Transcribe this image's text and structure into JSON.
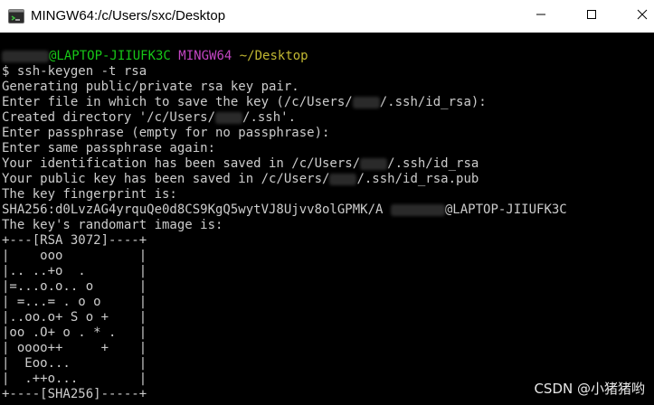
{
  "window": {
    "title": "MINGW64:/c/Users/sxc/Desktop"
  },
  "prompt": {
    "user_at_host": "@LAPTOP-JIIUFK3C",
    "shell": "MINGW64",
    "cwd": "~/Desktop",
    "symbol": "$",
    "command": "ssh-keygen -t rsa"
  },
  "output": {
    "l1": "Generating public/private rsa key pair.",
    "l2a": "Enter file in which to save the key (/c/Users/",
    "l2b": "/.ssh/id_rsa):",
    "l3a": "Created directory '/c/Users/",
    "l3b": "/.ssh'.",
    "l4": "Enter passphrase (empty for no passphrase):",
    "l5": "Enter same passphrase again:",
    "l6a": "Your identification has been saved in /c/Users/",
    "l6b": "/.ssh/id_rsa",
    "l7a": "Your public key has been saved in /c/Users/",
    "l7b": "/.ssh/id_rsa.pub",
    "l8": "The key fingerprint is:",
    "l9a": "SHA256:d0LvzAG4yrquQe0d8CS9KgQ5wytVJ8Ujvv8olGPMK/A",
    "l9b": "@LAPTOP-JIIUFK3C",
    "l10": "The key's randomart image is:"
  },
  "randomart": [
    "+---[RSA 3072]----+",
    "|    ooo          |",
    "|.. ..+o  .       |",
    "|=...o.o.. o      |",
    "| =...= . o o     |",
    "|..oo.o+ S o +    |",
    "|oo .O+ o . * .   |",
    "| oooo++     +    |",
    "|  Eoo...         |",
    "|  .++o...        |",
    "+----[SHA256]-----+"
  ],
  "watermark": "CSDN @小猪猪哟",
  "colors": {
    "background": "#000000",
    "text": "#cccccc",
    "prompt_user": "#17c717",
    "prompt_shell": "#c245c2",
    "prompt_path": "#c2b832"
  },
  "icons": {
    "app": "git-bash-icon",
    "minimize": "minimize-icon",
    "maximize": "maximize-icon",
    "close": "close-icon"
  }
}
